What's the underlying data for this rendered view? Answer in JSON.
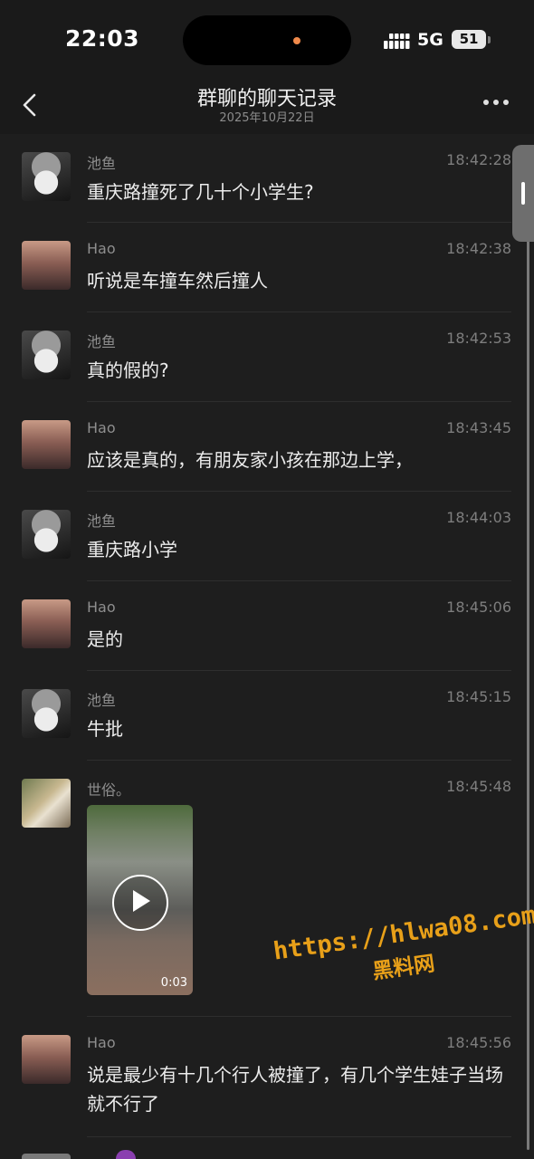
{
  "status_bar": {
    "time": "22:03",
    "network": "5G",
    "battery": "51"
  },
  "nav": {
    "title": "群聊的聊天记录",
    "subtitle": "2025年10月22日"
  },
  "messages": [
    {
      "sender": "池鱼",
      "time": "18:42:28",
      "text": "重庆路撞死了几十个小学生?",
      "avatar": "anime-avatar"
    },
    {
      "sender": "Hao",
      "time": "18:42:38",
      "text": "听说是车撞车然后撞人",
      "avatar": "sunset-avatar"
    },
    {
      "sender": "池鱼",
      "time": "18:42:53",
      "text": "真的假的?",
      "avatar": "anime-avatar"
    },
    {
      "sender": "Hao",
      "time": "18:43:45",
      "text": "应该是真的，有朋友家小孩在那边上学，",
      "avatar": "sunset-avatar"
    },
    {
      "sender": "池鱼",
      "time": "18:44:03",
      "text": "重庆路小学",
      "avatar": "anime-avatar"
    },
    {
      "sender": "Hao",
      "time": "18:45:06",
      "text": "是的",
      "avatar": "sunset-avatar"
    },
    {
      "sender": "池鱼",
      "time": "18:45:15",
      "text": "牛批",
      "avatar": "anime-avatar"
    },
    {
      "sender": "世俗。",
      "time": "18:45:48",
      "video_duration": "0:03",
      "avatar": "photo-avatar"
    },
    {
      "sender": "Hao",
      "time": "18:45:56",
      "text": "说是最少有十几个行人被撞了，有几个学生娃子当场就不行了",
      "avatar": "sunset-avatar"
    }
  ],
  "watermark": {
    "url": "https://hlwa08.com",
    "name": "黑料网",
    "color": "#e8a019"
  }
}
